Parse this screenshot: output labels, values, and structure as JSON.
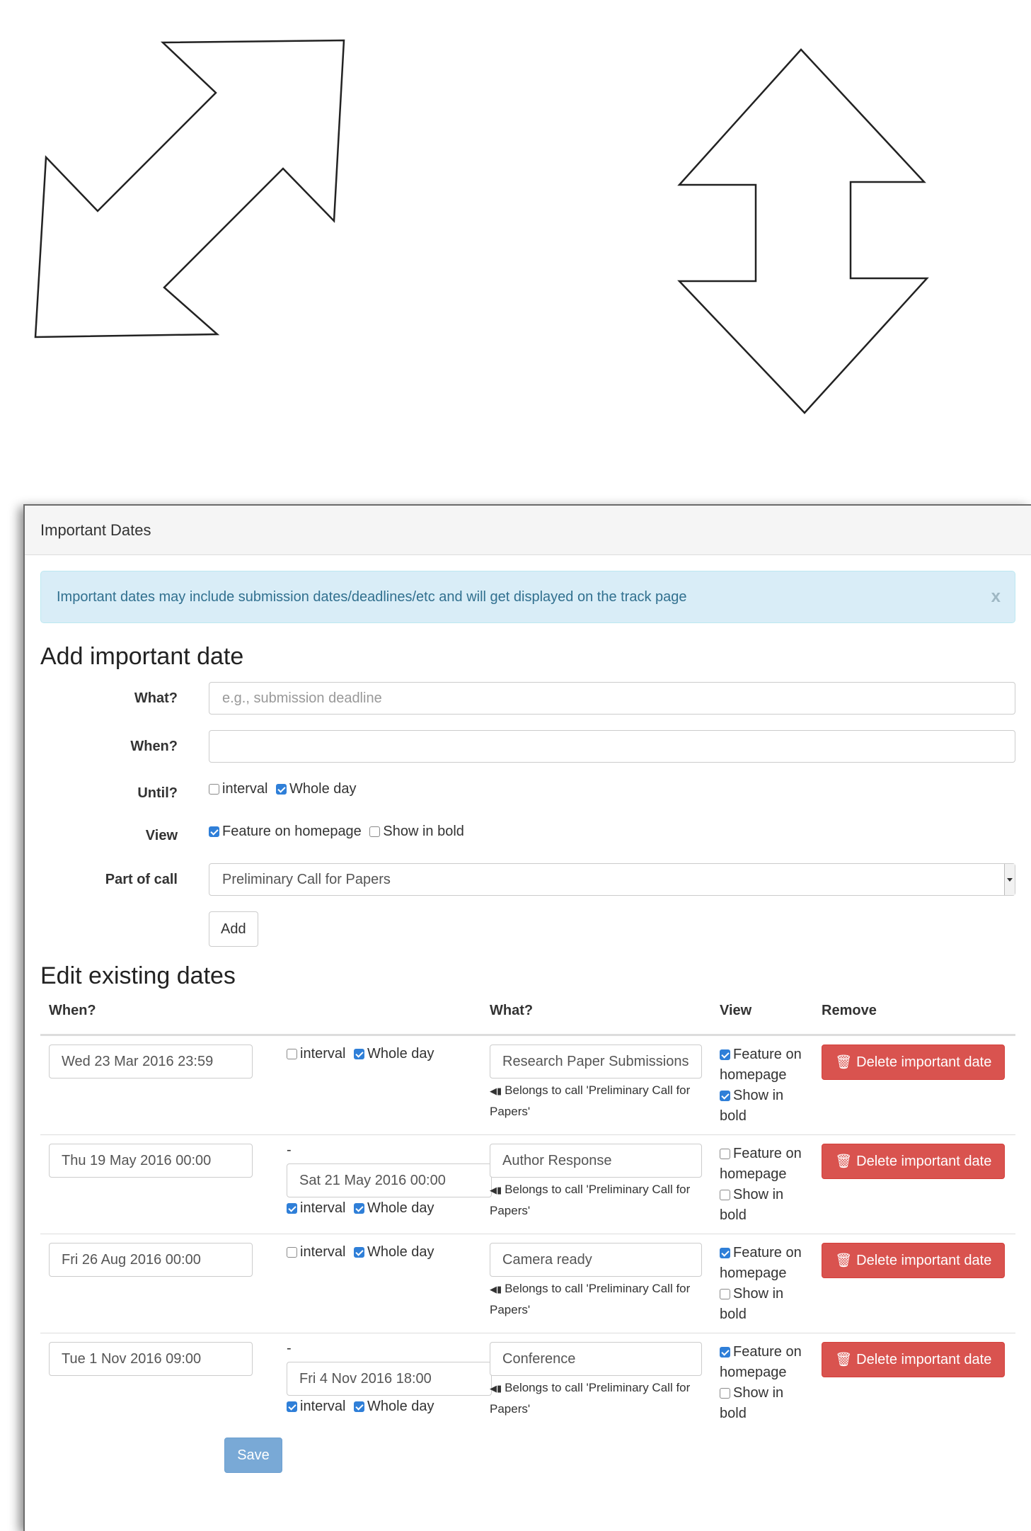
{
  "panel": {
    "title": "Important Dates"
  },
  "alert": {
    "text": "Important dates may include submission dates/deadlines/etc and will get displayed on the track page",
    "close": "x"
  },
  "add": {
    "heading": "Add important date",
    "what_label": "What?",
    "what_placeholder": "e.g., submission deadline",
    "when_label": "When?",
    "when_value": "",
    "until_label": "Until?",
    "interval_label": "interval",
    "interval_checked": false,
    "whole_day_label": "Whole day",
    "whole_day_checked": true,
    "view_label": "View",
    "feature_label": "Feature on homepage",
    "feature_checked": true,
    "bold_label": "Show in bold",
    "bold_checked": false,
    "call_label": "Part of call",
    "call_value": "Preliminary Call for Papers",
    "add_button": "Add"
  },
  "edit": {
    "heading": "Edit existing dates",
    "columns": {
      "when": "When?",
      "what": "What?",
      "view": "View",
      "remove": "Remove"
    },
    "interval_label": "interval",
    "whole_day_label": "Whole day",
    "dash": "-",
    "feature_on": "Feature on",
    "homepage": "homepage",
    "show_in": "Show in",
    "bold": "bold",
    "belongs_to": "Belongs to call 'Preliminary Call for",
    "belongs_to_2": "Papers'",
    "delete_label": "Delete important date",
    "rows": [
      {
        "when": "Wed 23 Mar 2016 23:59",
        "until": "",
        "interval": false,
        "whole_day": true,
        "what": "Research Paper Submissions",
        "feature": true,
        "bold": true
      },
      {
        "when": "Thu 19 May 2016 00:00",
        "until": "Sat 21 May 2016 00:00",
        "interval": true,
        "whole_day": true,
        "what": "Author Response",
        "feature": false,
        "bold": false
      },
      {
        "when": "Fri 26 Aug 2016 00:00",
        "until": "",
        "interval": false,
        "whole_day": true,
        "what": "Camera ready",
        "feature": true,
        "bold": false
      },
      {
        "when": "Tue 1 Nov 2016 09:00",
        "until": "Fri 4 Nov 2016 18:00",
        "interval": true,
        "whole_day": true,
        "what": "Conference",
        "feature": true,
        "bold": false
      }
    ],
    "save_button": "Save"
  },
  "icons": {
    "diagonal_arrow": "double-diagonal-arrow-icon",
    "vertical_arrow": "double-vertical-arrow-icon",
    "trash": "trash-icon",
    "megaphone": "megaphone-icon"
  },
  "colors": {
    "danger": "#d9534f",
    "primary_disabled": "#79a9d6",
    "alert_bg": "#d9edf7",
    "alert_text": "#31708f",
    "checkbox_on": "#2f7fd8"
  }
}
